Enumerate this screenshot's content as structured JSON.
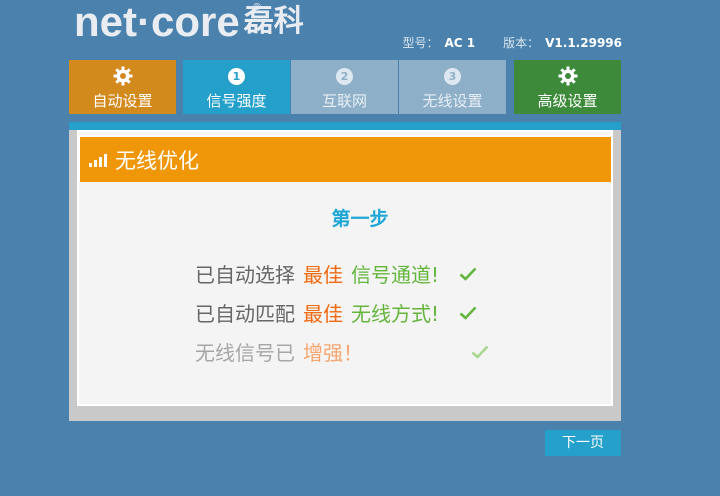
{
  "brand": {
    "logo_main": "net·core",
    "logo_cn": "磊科",
    "reg_mark": "®"
  },
  "device_info": {
    "model_label": "型号：",
    "model_value": "AC 1",
    "version_label": "版本：",
    "version_value": "V1.1.29996"
  },
  "nav": {
    "tabs": [
      {
        "label": "自动设置",
        "icon": "gear-icon",
        "state": "done"
      },
      {
        "label": "信号强度",
        "number": "1",
        "state": "active"
      },
      {
        "label": "互联网",
        "number": "2",
        "state": "inactive"
      },
      {
        "label": "无线设置",
        "number": "3",
        "state": "inactive"
      },
      {
        "label": "高级设置",
        "icon": "gear-icon",
        "state": "normal"
      }
    ]
  },
  "section": {
    "title": "无线优化",
    "icon": "signal-bars-icon"
  },
  "step": {
    "title": "第一步"
  },
  "lines": [
    {
      "prefix": "已自动选择",
      "highlight": "最佳",
      "suffix": "信号通道!",
      "check": "check-icon"
    },
    {
      "prefix": "已自动匹配",
      "highlight": "最佳",
      "suffix": "无线方式!",
      "check": "check-icon"
    },
    {
      "prefix": "无线信号已",
      "highlight": "增强！",
      "suffix": "",
      "check": "check-icon"
    }
  ],
  "buttons": {
    "next_label": "下一页"
  },
  "colors": {
    "background": "#4a81ad",
    "orange": "#ef9709",
    "blue_active": "#24a0cb",
    "green_adv": "#3c8a3a",
    "highlight_orange": "#ef6a10",
    "text_green": "#63b53b"
  }
}
